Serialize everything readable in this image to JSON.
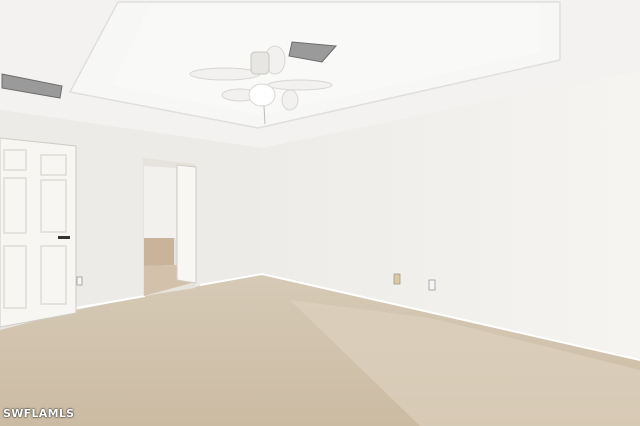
{
  "watermark": {
    "text": "SWFLAMLS"
  },
  "scene": {
    "type": "empty bedroom interior photo",
    "colors": {
      "ceiling": "#f3f2f0",
      "wall_left": "#eeede9",
      "wall_right": "#f2f1ee",
      "carpet": "#d8cbb7",
      "door": "#f7f6f3",
      "vent": "#8a8a8a"
    }
  }
}
